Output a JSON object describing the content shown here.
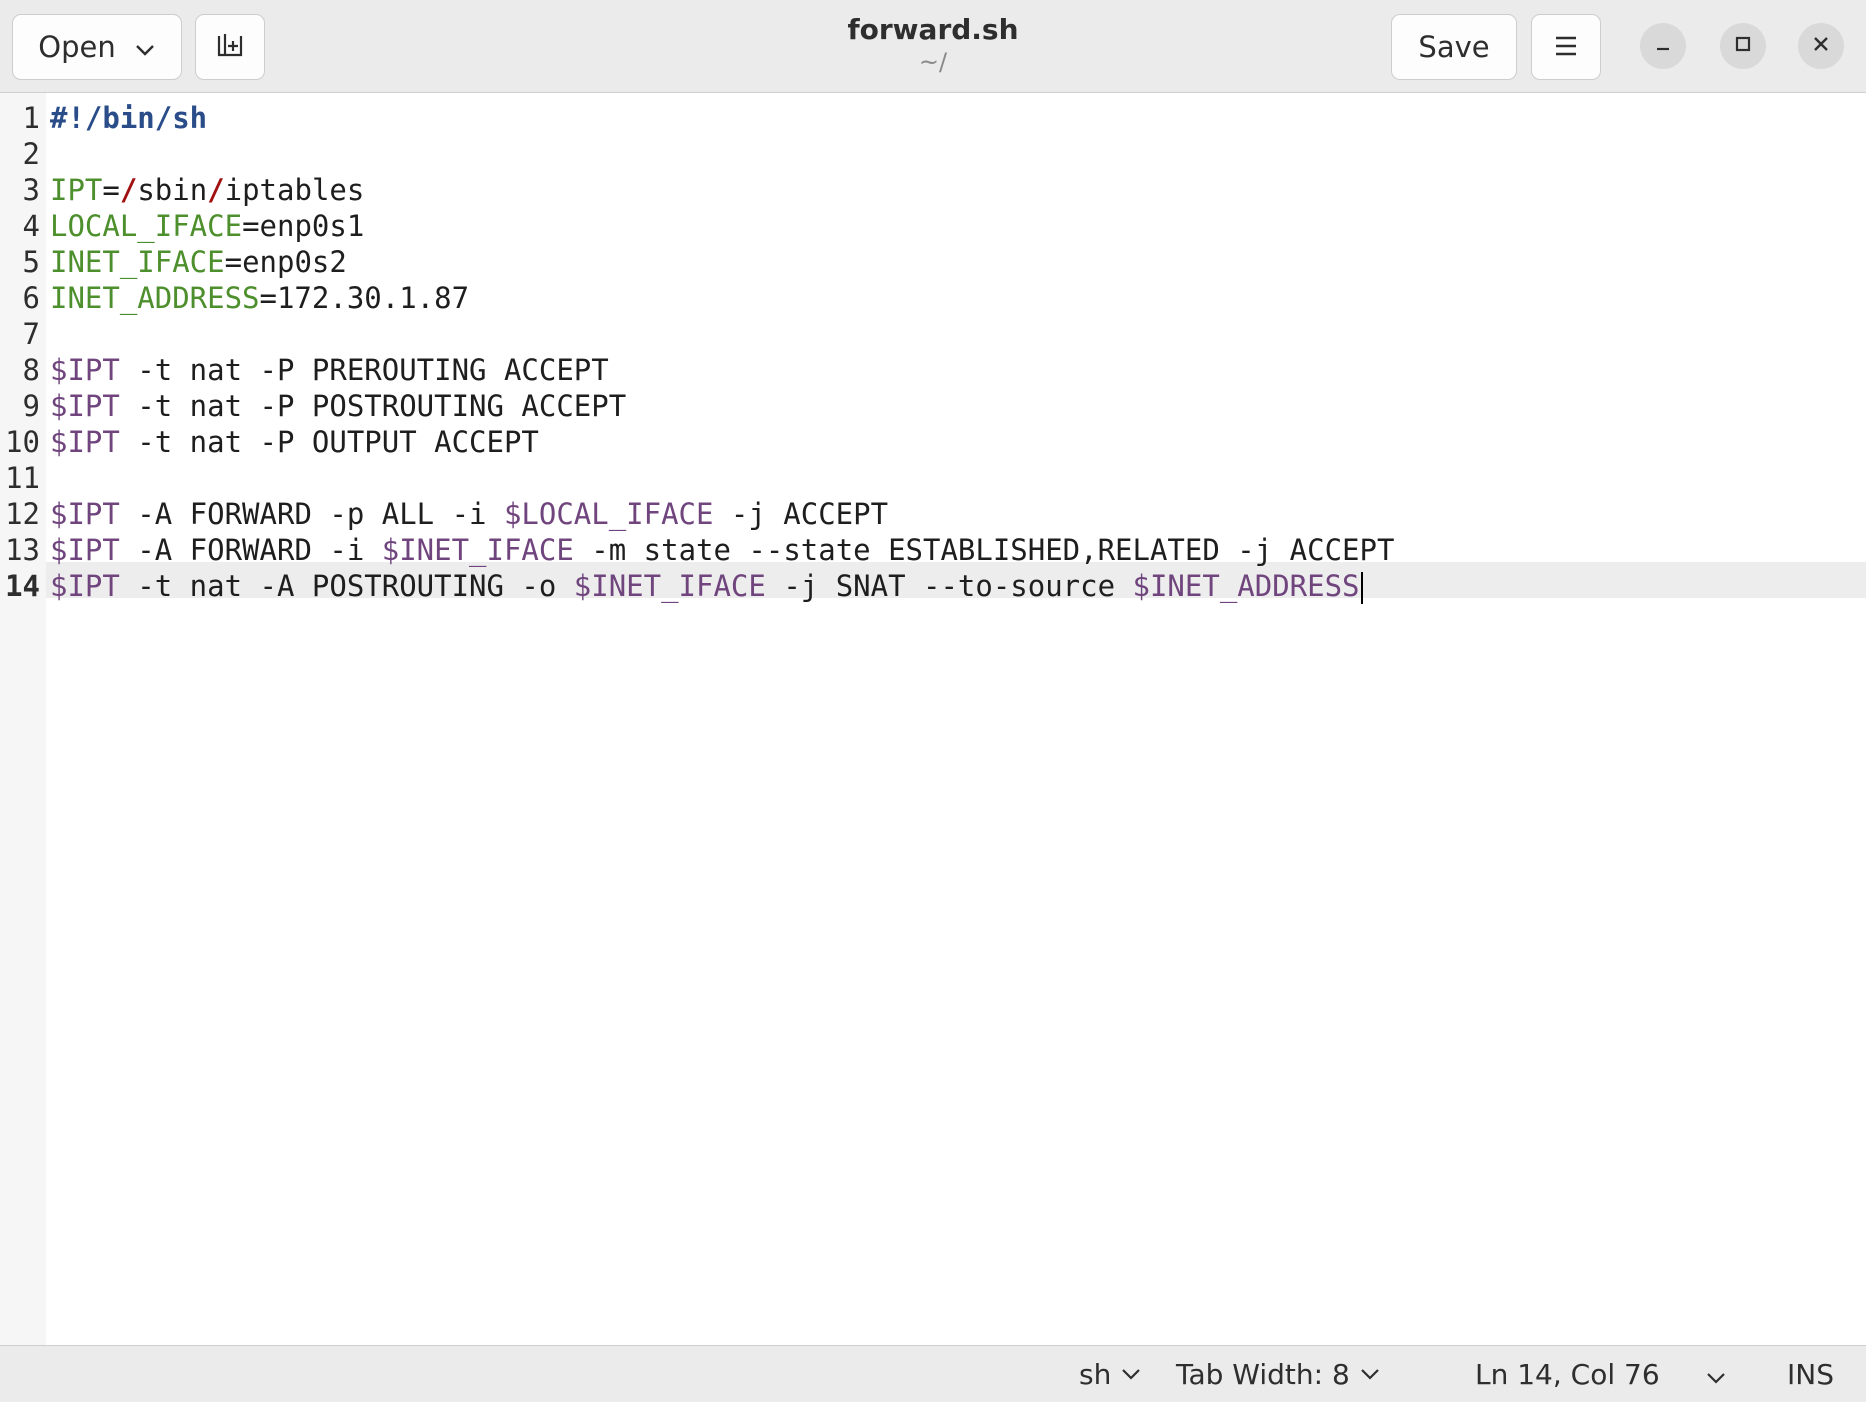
{
  "window": {
    "title": "forward.sh",
    "subtitle": "~/"
  },
  "header": {
    "open_label": "Open",
    "save_label": "Save"
  },
  "editor": {
    "current_line": 14,
    "lines": [
      {
        "n": "1",
        "tokens": [
          {
            "t": "#!/bin/sh",
            "c": "shebang"
          }
        ]
      },
      {
        "n": "2",
        "tokens": []
      },
      {
        "n": "3",
        "tokens": [
          {
            "t": "IPT",
            "c": "var"
          },
          {
            "t": "=",
            "c": "plain"
          },
          {
            "t": "/",
            "c": "slash"
          },
          {
            "t": "sbin",
            "c": "plain"
          },
          {
            "t": "/",
            "c": "slash"
          },
          {
            "t": "iptables",
            "c": "plain"
          }
        ]
      },
      {
        "n": "4",
        "tokens": [
          {
            "t": "LOCAL_IFACE",
            "c": "var"
          },
          {
            "t": "=enp0s1",
            "c": "plain"
          }
        ]
      },
      {
        "n": "5",
        "tokens": [
          {
            "t": "INET_IFACE",
            "c": "var"
          },
          {
            "t": "=enp0s2",
            "c": "plain"
          }
        ]
      },
      {
        "n": "6",
        "tokens": [
          {
            "t": "INET_ADDRESS",
            "c": "var"
          },
          {
            "t": "=172.30.1.87",
            "c": "plain"
          }
        ]
      },
      {
        "n": "7",
        "tokens": []
      },
      {
        "n": "8",
        "tokens": [
          {
            "t": "$IPT",
            "c": "ref"
          },
          {
            "t": " -t nat -P PREROUTING ACCEPT",
            "c": "plain"
          }
        ]
      },
      {
        "n": "9",
        "tokens": [
          {
            "t": "$IPT",
            "c": "ref"
          },
          {
            "t": " -t nat -P POSTROUTING ACCEPT",
            "c": "plain"
          }
        ]
      },
      {
        "n": "10",
        "tokens": [
          {
            "t": "$IPT",
            "c": "ref"
          },
          {
            "t": " -t nat -P OUTPUT ACCEPT",
            "c": "plain"
          }
        ]
      },
      {
        "n": "11",
        "tokens": []
      },
      {
        "n": "12",
        "tokens": [
          {
            "t": "$IPT",
            "c": "ref"
          },
          {
            "t": " -A FORWARD -p ALL -i ",
            "c": "plain"
          },
          {
            "t": "$LOCAL_IFACE",
            "c": "ref"
          },
          {
            "t": " -j ACCEPT",
            "c": "plain"
          }
        ]
      },
      {
        "n": "13",
        "tokens": [
          {
            "t": "$IPT",
            "c": "ref"
          },
          {
            "t": " -A FORWARD -i ",
            "c": "plain"
          },
          {
            "t": "$INET_IFACE",
            "c": "ref"
          },
          {
            "t": " -m state --state ESTABLISHED,RELATED -j ACCEPT",
            "c": "plain"
          }
        ]
      },
      {
        "n": "14",
        "tokens": [
          {
            "t": "$IPT",
            "c": "ref"
          },
          {
            "t": " -t nat -A POSTROUTING -o ",
            "c": "plain"
          },
          {
            "t": "$INET_IFACE",
            "c": "ref"
          },
          {
            "t": " -j SNAT --to-source ",
            "c": "plain"
          },
          {
            "t": "$INET_ADDRESS",
            "c": "ref"
          }
        ]
      }
    ]
  },
  "statusbar": {
    "language": "sh",
    "tab_width": "Tab Width: 8",
    "position": "Ln 14, Col 76",
    "mode": "INS"
  },
  "icons": {
    "open_dropdown": "chevron-down-icon",
    "new_tab": "new-tab-icon",
    "menu": "hamburger-menu-icon",
    "minimize": "minimize-icon",
    "maximize": "maximize-icon",
    "close": "close-icon"
  }
}
